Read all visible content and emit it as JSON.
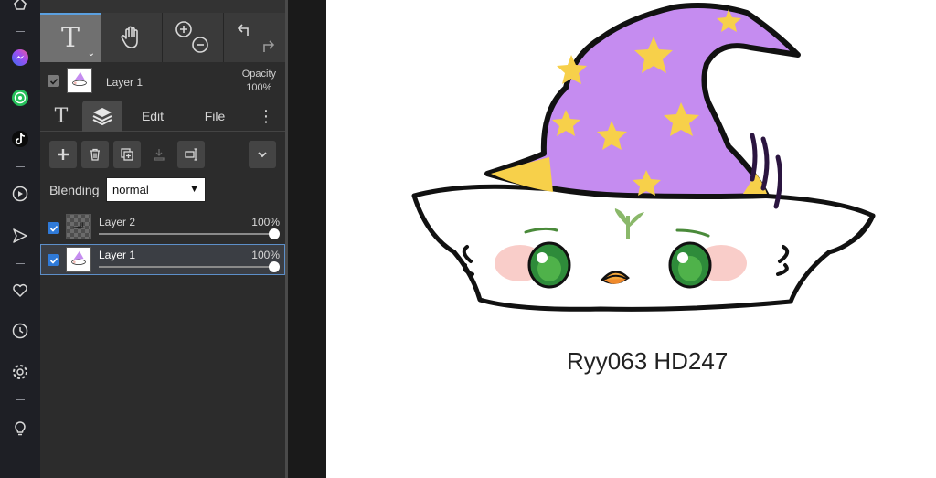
{
  "toolbar": {
    "tools": [
      {
        "name": "text-tool",
        "glyph": "T",
        "active": true
      },
      {
        "name": "hand-tool"
      },
      {
        "name": "zoom-tool"
      },
      {
        "name": "undo-redo"
      }
    ]
  },
  "layer_summary": {
    "name": "Layer 1",
    "opacity_label": "Opacity",
    "opacity_value": "100%"
  },
  "tabs": [
    {
      "label": "T",
      "kind": "text-tab"
    },
    {
      "label": "",
      "kind": "layers-tab",
      "active": true
    },
    {
      "label": "Edit",
      "kind": "edit-tab"
    },
    {
      "label": "File",
      "kind": "file-tab"
    },
    {
      "label": "⋮",
      "kind": "more-tab"
    }
  ],
  "blending": {
    "label": "Blending",
    "value": "normal"
  },
  "layers": [
    {
      "name": "Layer 2",
      "opacity": "100%",
      "selected": false,
      "opacity_level": 1.0
    },
    {
      "name": "Layer 1",
      "opacity": "100%",
      "selected": true,
      "opacity_level": 1.0
    }
  ],
  "canvas": {
    "caption": "Ryy063 HD247"
  },
  "sidebar_icons": [
    "extension-icon",
    "messenger-icon",
    "whatsapp-icon",
    "tiktok-icon",
    "player-icon",
    "send-icon",
    "heart-icon",
    "history-icon",
    "settings-icon",
    "lightbulb-icon"
  ],
  "colors": {
    "panel": "#2c2c2c",
    "accent": "#2f7ad8",
    "hat": "#c58cf0",
    "star": "#f7d04a",
    "blush": "#f5b7b0",
    "eye": "#2e8b3a"
  }
}
